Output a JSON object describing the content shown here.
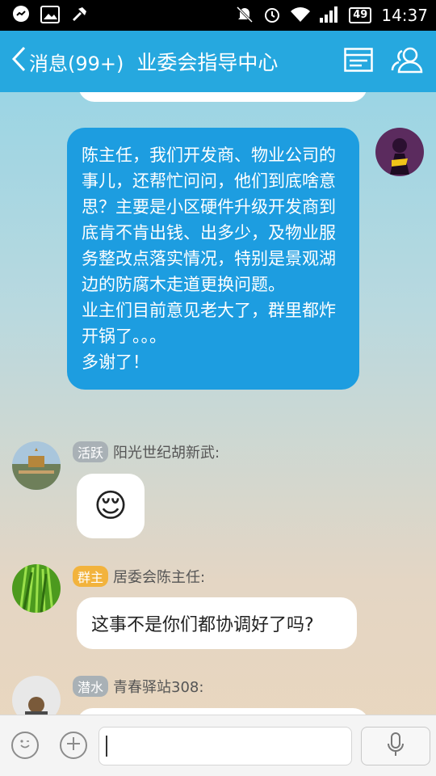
{
  "status_bar": {
    "left_icons": [
      "messenger-icon",
      "image-icon",
      "hammer-icon"
    ],
    "right_icons": [
      "mute-icon",
      "alarm-icon",
      "wifi-icon",
      "signal-icon"
    ],
    "battery": "49",
    "time": "14:37"
  },
  "title_bar": {
    "back_label": "消息(99+)",
    "title": "业委会指导中心",
    "accent": "#26a8df"
  },
  "messages": [
    {
      "direction": "out",
      "text": "陈主任，我们开发商、物业公司的事儿，还帮忙问问，他们到底啥意思？主要是小区硬件升级开发商到底肯不肯出钱、出多少，及物业服务整改点落实情况，特别是景观湖边的防腐木走道更换问题。\n业主们目前意见老大了，群里都炸开锅了。。。\n多谢了！"
    },
    {
      "direction": "in",
      "badge": "活跃",
      "sender": "阳光世纪胡新武:",
      "content_type": "emoji",
      "emoji": "😌"
    },
    {
      "direction": "in",
      "badge": "群主",
      "sender": "居委会陈主任:",
      "text": "这事不是你们都协调好了吗?"
    },
    {
      "direction": "in",
      "badge": "潜水",
      "sender": "青春驿站308:"
    }
  ],
  "input_bar": {
    "emoji_button": "emoji-icon",
    "plus_button": "plus-icon",
    "voice_button": "microphone-icon"
  }
}
